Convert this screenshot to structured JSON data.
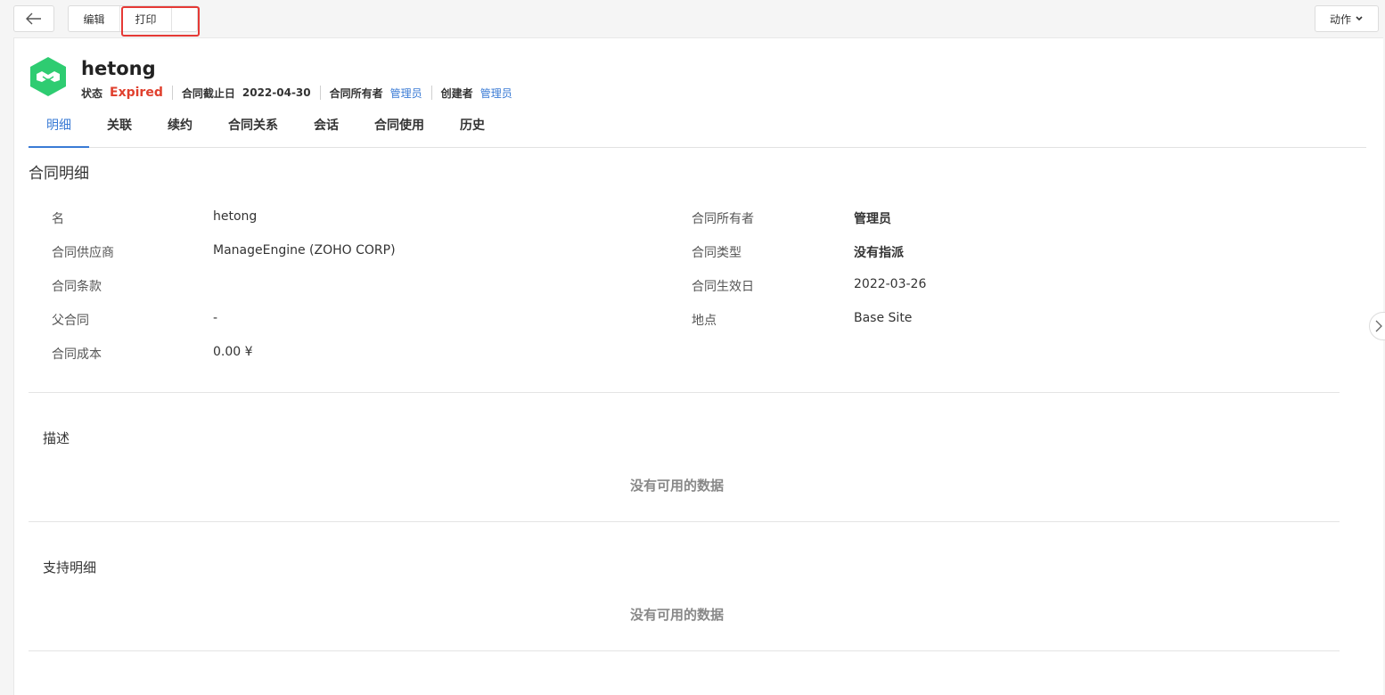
{
  "toolbar": {
    "edit_label": "编辑",
    "print_label": "打印",
    "actions_label": "动作"
  },
  "header": {
    "title": "hetong",
    "status_label": "状态",
    "status_value": "Expired",
    "end_date_label": "合同截止日",
    "end_date_value": "2022-04-30",
    "owner_label": "合同所有者",
    "owner_value": "管理员",
    "creator_label": "创建者",
    "creator_value": "管理员"
  },
  "tabs": [
    {
      "label": "明细"
    },
    {
      "label": "关联"
    },
    {
      "label": "续约"
    },
    {
      "label": "合同关系"
    },
    {
      "label": "会话"
    },
    {
      "label": "合同使用"
    },
    {
      "label": "历史"
    }
  ],
  "details": {
    "section_title": "合同明细",
    "left": [
      {
        "label": "名",
        "value": "hetong"
      },
      {
        "label": "合同供应商",
        "value": "ManageEngine (ZOHO CORP)"
      },
      {
        "label": "合同条款",
        "value": ""
      },
      {
        "label": "父合同",
        "value": "-"
      },
      {
        "label": "合同成本",
        "value": "0.00 ¥"
      }
    ],
    "right": [
      {
        "label": "合同所有者",
        "value": "管理员"
      },
      {
        "label": "合同类型",
        "value": "没有指派"
      },
      {
        "label": "合同生效日",
        "value": "2022-03-26"
      },
      {
        "label": "地点",
        "value": "Base Site"
      }
    ]
  },
  "description": {
    "title": "描述",
    "empty_text": "没有可用的数据"
  },
  "support": {
    "title": "支持明细",
    "empty_text": "没有可用的数据"
  },
  "colors": {
    "accent": "#3a7bd5",
    "expired": "#e0402e",
    "logo": "#2ecc71",
    "highlight": "#e53935"
  },
  "icons": {
    "back": "arrow-left-icon",
    "logo": "handshake-icon",
    "actions": "chevron-down-icon",
    "side": "chevron-right-icon"
  }
}
